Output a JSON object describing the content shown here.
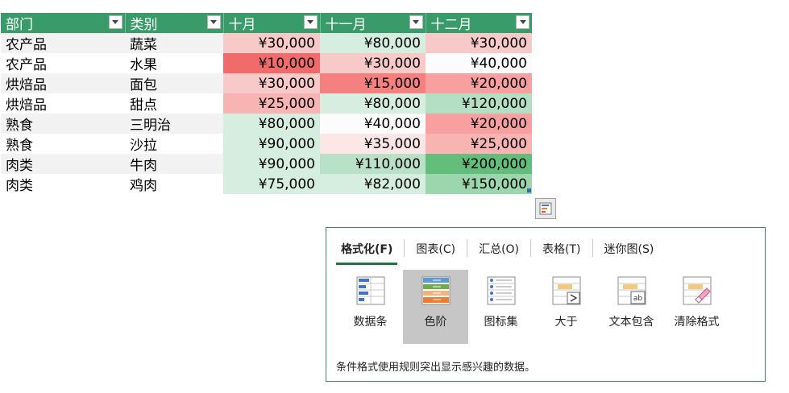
{
  "table": {
    "headers": [
      "部门",
      "类别",
      "十月",
      "十一月",
      "十二月"
    ],
    "rows": [
      {
        "dept": "农产品",
        "cat": "蔬菜",
        "oct": "¥30,000",
        "nov": "¥80,000",
        "dec": "¥30,000"
      },
      {
        "dept": "农产品",
        "cat": "水果",
        "oct": "¥10,000",
        "nov": "¥30,000",
        "dec": "¥40,000"
      },
      {
        "dept": "烘焙品",
        "cat": "面包",
        "oct": "¥30,000",
        "nov": "¥15,000",
        "dec": "¥20,000"
      },
      {
        "dept": "烘焙品",
        "cat": "甜点",
        "oct": "¥25,000",
        "nov": "¥80,000",
        "dec": "¥120,000"
      },
      {
        "dept": "熟食",
        "cat": "三明治",
        "oct": "¥80,000",
        "nov": "¥40,000",
        "dec": "¥20,000"
      },
      {
        "dept": "熟食",
        "cat": "沙拉",
        "oct": "¥90,000",
        "nov": "¥35,000",
        "dec": "¥25,000"
      },
      {
        "dept": "肉类",
        "cat": "牛肉",
        "oct": "¥90,000",
        "nov": "¥110,000",
        "dec": "¥200,000"
      },
      {
        "dept": "肉类",
        "cat": "鸡肉",
        "oct": "¥75,000",
        "nov": "¥82,000",
        "dec": "¥150,000"
      }
    ],
    "cell_colors": {
      "oct": [
        "#f8c9c9",
        "#f26b6b",
        "#f8c9c9",
        "#f8b3b3",
        "#d6eedf",
        "#d6eedf",
        "#d6eedf",
        "#d6eedf"
      ],
      "nov": [
        "#d6eedf",
        "#f8c9c9",
        "#f48080",
        "#d6eedf",
        "#fcfcfc",
        "#fde6e6",
        "#b9e1c8",
        "#d6eedf"
      ],
      "dec": [
        "#f8c9c9",
        "#fcfcfc",
        "#f8a0a0",
        "#b3e0c2",
        "#f8a0a0",
        "#f8b3b3",
        "#63be7b",
        "#9bd6ad"
      ]
    },
    "header_bg": "#3a9b6a"
  },
  "quick_analysis": {
    "tabs": [
      "格式化(F)",
      "图表(C)",
      "汇总(O)",
      "表格(T)",
      "迷你图(S)"
    ],
    "tools": [
      {
        "label": "数据条",
        "icon": "data-bars-icon"
      },
      {
        "label": "色阶",
        "icon": "color-scale-icon"
      },
      {
        "label": "图标集",
        "icon": "icon-set-icon"
      },
      {
        "label": "大于",
        "icon": "greater-than-icon"
      },
      {
        "label": "文本包含",
        "icon": "text-contains-icon"
      },
      {
        "label": "清除格式",
        "icon": "clear-format-icon"
      }
    ],
    "selected_tool": "色阶",
    "description": "条件格式使用规则突出显示感兴趣的数据。",
    "accent": "#217346"
  }
}
